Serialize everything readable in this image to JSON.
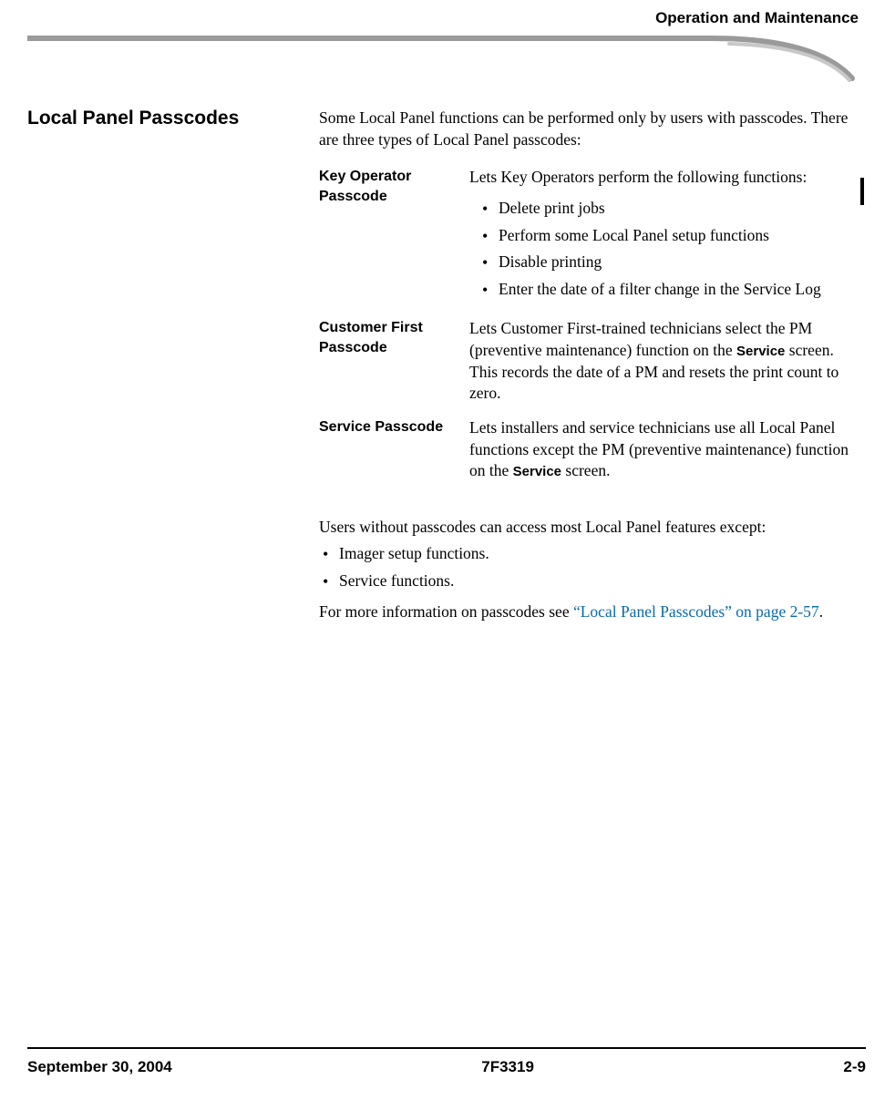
{
  "header": {
    "section_title": "Operation and Maintenance"
  },
  "side_heading": "Local Panel Passcodes",
  "intro": "Some Local Panel functions can be performed only by users with passcodes. There are three types of Local Panel passcodes:",
  "definitions": [
    {
      "term": "Key Operator Passcode",
      "desc_lead": "Lets Key Operators perform the following functions:",
      "bullets": [
        "Delete print jobs",
        "Perform some Local Panel setup functions",
        "Disable printing",
        "Enter the date of a filter change in the Service Log"
      ]
    },
    {
      "term": "Customer First Passcode",
      "desc_parts": {
        "before": "Lets Customer First-trained technicians select the PM (preventive maintenance) function on the ",
        "bold": "Service",
        "after": " screen. This records the date of a PM and resets the print count to zero."
      }
    },
    {
      "term": "Service Passcode",
      "desc_parts": {
        "before": "Lets installers and service technicians use all Local Panel functions except the PM (preventive maintenance) function on the ",
        "bold": "Service",
        "after": " screen."
      }
    }
  ],
  "except_intro": "Users without passcodes can access most Local Panel features except:",
  "except_bullets": [
    "Imager setup functions.",
    "Service functions."
  ],
  "more_info": {
    "before": "For more information on passcodes see ",
    "link": "“Local Panel Passcodes” on page 2-57",
    "after": "."
  },
  "footer": {
    "date": "September 30, 2004",
    "doc_id": "7F3319",
    "page_num": "2-9"
  }
}
